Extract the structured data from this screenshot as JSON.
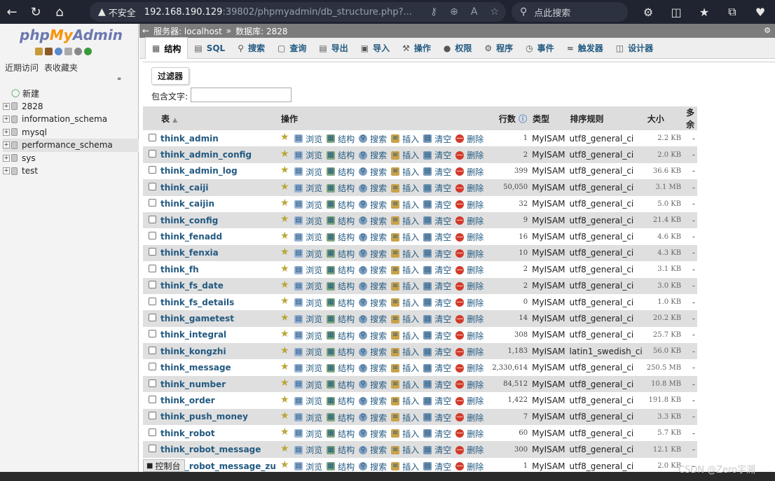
{
  "browser": {
    "insecure_label": "不安全",
    "url_main": "192.168.190.129",
    "url_rest": ":39802/phpmyadmin/db_structure.php?...",
    "search_placeholder": "点此搜索"
  },
  "nav": {
    "logo_php": "php",
    "logo_my": "My",
    "logo_admin": "Admin",
    "recent": "近期访问",
    "favorites": "表收藏夹",
    "tree": [
      {
        "label": "新建",
        "type": "new"
      },
      {
        "label": "2828",
        "type": "db"
      },
      {
        "label": "information_schema",
        "type": "db"
      },
      {
        "label": "mysql",
        "type": "db"
      },
      {
        "label": "performance_schema",
        "type": "db",
        "selected": true
      },
      {
        "label": "sys",
        "type": "db"
      },
      {
        "label": "test",
        "type": "db"
      }
    ]
  },
  "breadcrumb": {
    "server": "服务器: localhost",
    "sep": "»",
    "database": "数据库: 2828"
  },
  "tabs": [
    {
      "label": "结构",
      "icon": "structure-icon",
      "active": true
    },
    {
      "label": "SQL",
      "icon": "sql-icon"
    },
    {
      "label": "搜索",
      "icon": "search-icon"
    },
    {
      "label": "查询",
      "icon": "query-icon"
    },
    {
      "label": "导出",
      "icon": "export-icon"
    },
    {
      "label": "导入",
      "icon": "import-icon"
    },
    {
      "label": "操作",
      "icon": "operations-icon"
    },
    {
      "label": "权限",
      "icon": "privileges-icon"
    },
    {
      "label": "程序",
      "icon": "routines-icon"
    },
    {
      "label": "事件",
      "icon": "events-icon"
    },
    {
      "label": "触发器",
      "icon": "triggers-icon"
    },
    {
      "label": "设计器",
      "icon": "designer-icon"
    }
  ],
  "filter": {
    "legend": "过滤器",
    "label": "包含文字:"
  },
  "table": {
    "headers": {
      "table": "表",
      "action": "操作",
      "rows": "行数",
      "type": "类型",
      "collation": "排序规则",
      "size": "大小",
      "overhead": "多余"
    },
    "actions": {
      "browse": "浏览",
      "structure": "结构",
      "search": "搜索",
      "insert": "插入",
      "empty": "清空",
      "drop": "删除"
    },
    "rows": [
      {
        "name": "think_admin",
        "rows": "1",
        "type": "MyISAM",
        "collation": "utf8_general_ci",
        "size": "2.2 KB",
        "overhead": "-"
      },
      {
        "name": "think_admin_config",
        "rows": "2",
        "type": "MyISAM",
        "collation": "utf8_general_ci",
        "size": "2.0 KB",
        "overhead": "-"
      },
      {
        "name": "think_admin_log",
        "rows": "399",
        "type": "MyISAM",
        "collation": "utf8_general_ci",
        "size": "36.6 KB",
        "overhead": "-"
      },
      {
        "name": "think_caiji",
        "rows": "50,050",
        "type": "MyISAM",
        "collation": "utf8_general_ci",
        "size": "3.1 MB",
        "overhead": "-"
      },
      {
        "name": "think_caijin",
        "rows": "32",
        "type": "MyISAM",
        "collation": "utf8_general_ci",
        "size": "5.0 KB",
        "overhead": "-"
      },
      {
        "name": "think_config",
        "rows": "9",
        "type": "MyISAM",
        "collation": "utf8_general_ci",
        "size": "21.4 KB",
        "overhead": "-"
      },
      {
        "name": "think_fenadd",
        "rows": "16",
        "type": "MyISAM",
        "collation": "utf8_general_ci",
        "size": "4.6 KB",
        "overhead": "-"
      },
      {
        "name": "think_fenxia",
        "rows": "10",
        "type": "MyISAM",
        "collation": "utf8_general_ci",
        "size": "4.3 KB",
        "overhead": "-"
      },
      {
        "name": "think_fh",
        "rows": "2",
        "type": "MyISAM",
        "collation": "utf8_general_ci",
        "size": "3.1 KB",
        "overhead": "-"
      },
      {
        "name": "think_fs_date",
        "rows": "2",
        "type": "MyISAM",
        "collation": "utf8_general_ci",
        "size": "3.0 KB",
        "overhead": "-"
      },
      {
        "name": "think_fs_details",
        "rows": "0",
        "type": "MyISAM",
        "collation": "utf8_general_ci",
        "size": "1.0 KB",
        "overhead": "-"
      },
      {
        "name": "think_gametest",
        "rows": "14",
        "type": "MyISAM",
        "collation": "utf8_general_ci",
        "size": "20.2 KB",
        "overhead": "-"
      },
      {
        "name": "think_integral",
        "rows": "308",
        "type": "MyISAM",
        "collation": "utf8_general_ci",
        "size": "25.7 KB",
        "overhead": "-"
      },
      {
        "name": "think_kongzhi",
        "rows": "1,183",
        "type": "MyISAM",
        "collation": "latin1_swedish_ci",
        "size": "56.0 KB",
        "overhead": "-"
      },
      {
        "name": "think_message",
        "rows": "2,330,614",
        "type": "MyISAM",
        "collation": "utf8_general_ci",
        "size": "250.5 MB",
        "overhead": "-"
      },
      {
        "name": "think_number",
        "rows": "84,512",
        "type": "MyISAM",
        "collation": "utf8_general_ci",
        "size": "10.8 MB",
        "overhead": "-"
      },
      {
        "name": "think_order",
        "rows": "1,422",
        "type": "MyISAM",
        "collation": "utf8_general_ci",
        "size": "191.8 KB",
        "overhead": "-"
      },
      {
        "name": "think_push_money",
        "rows": "7",
        "type": "MyISAM",
        "collation": "utf8_general_ci",
        "size": "3.3 KB",
        "overhead": "-"
      },
      {
        "name": "think_robot",
        "rows": "60",
        "type": "MyISAM",
        "collation": "utf8_general_ci",
        "size": "5.7 KB",
        "overhead": "-"
      },
      {
        "name": "think_robot_message",
        "rows": "300",
        "type": "MyISAM",
        "collation": "utf8_general_ci",
        "size": "12.1 KB",
        "overhead": "-"
      },
      {
        "name": "think_robot_message_zu",
        "rows": "1",
        "type": "MyISAM",
        "collation": "utf8_general_ci",
        "size": "2.0 KB",
        "overhead": "-"
      }
    ]
  },
  "console": {
    "label": "控制台"
  },
  "watermark": "CSDN @Zero宇溯"
}
